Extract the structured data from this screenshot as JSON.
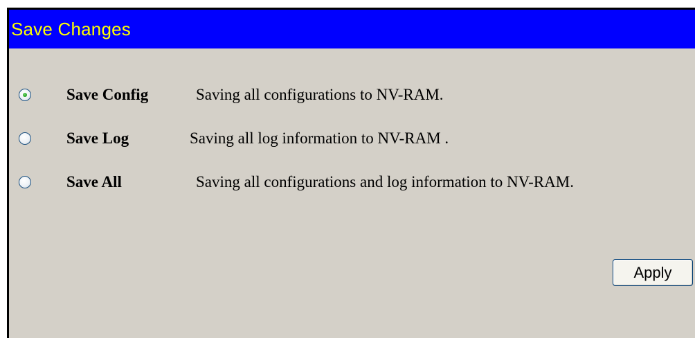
{
  "title": "Save Changes",
  "options": [
    {
      "label": "Save Config",
      "description": "Saving all configurations to NV-RAM.",
      "checked": true
    },
    {
      "label": "Save Log",
      "description": "Saving all log information to NV-RAM .",
      "checked": false
    },
    {
      "label": "Save All",
      "description": "Saving all configurations and log information to NV-RAM.",
      "checked": false
    }
  ],
  "apply_label": "Apply",
  "colors": {
    "title_bar": "#0000ff",
    "title_text": "#ffff00",
    "background": "#d4d0c8",
    "radio_dot": "#21a121"
  }
}
